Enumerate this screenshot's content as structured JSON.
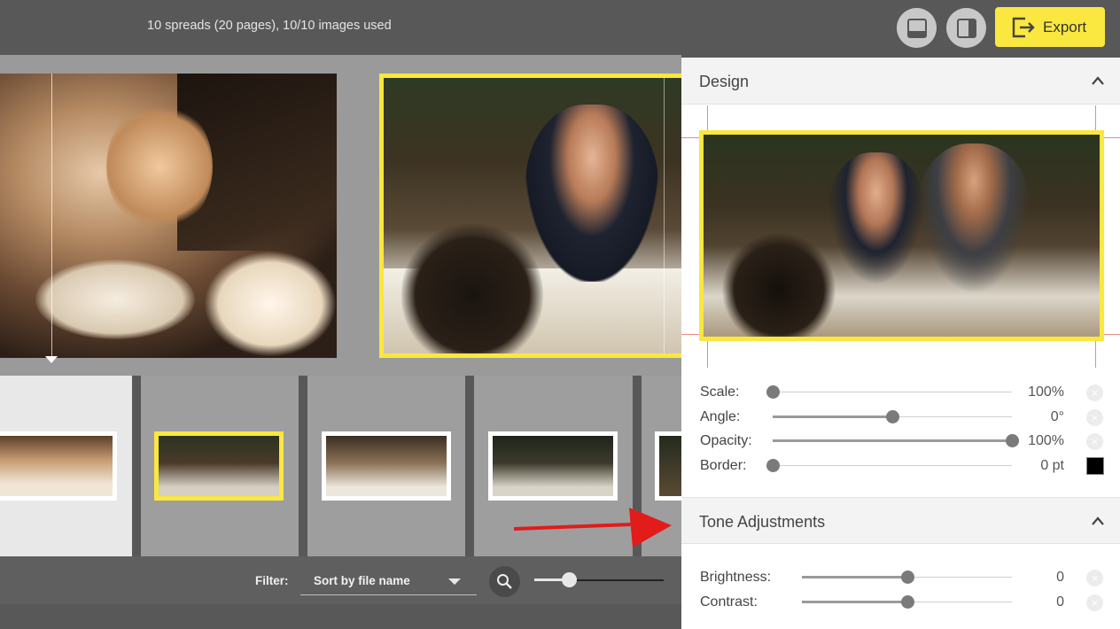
{
  "header": {
    "info": "10 spreads (20 pages), 10/10 images used",
    "buttons": {
      "layout_bottom_icon": "layout-bottom-icon",
      "layout_right_icon": "layout-right-icon",
      "export_label": "Export"
    }
  },
  "bottombar": {
    "filter_label": "Filter:",
    "sort_value": "Sort by file name",
    "zoom_level": 0.27
  },
  "panel": {
    "design": {
      "title": "Design",
      "controls": [
        {
          "label": "Scale:",
          "value": "100%",
          "level": 0.0
        },
        {
          "label": "Angle:",
          "value": "0°",
          "level": 0.5
        },
        {
          "label": "Opacity:",
          "value": "100%",
          "level": 1.0
        },
        {
          "label": "Border:",
          "value": "0 pt",
          "level": 0.0,
          "color": "#000000"
        }
      ]
    },
    "tone": {
      "title": "Tone Adjustments",
      "controls": [
        {
          "label": "Brightness:",
          "value": "0",
          "level": 0.5
        },
        {
          "label": "Contrast:",
          "value": "0",
          "level": 0.5
        }
      ]
    }
  },
  "colors": {
    "accent": "#fae740",
    "dark_bar": "#585858",
    "annotation_arrow": "#e21b1b"
  }
}
